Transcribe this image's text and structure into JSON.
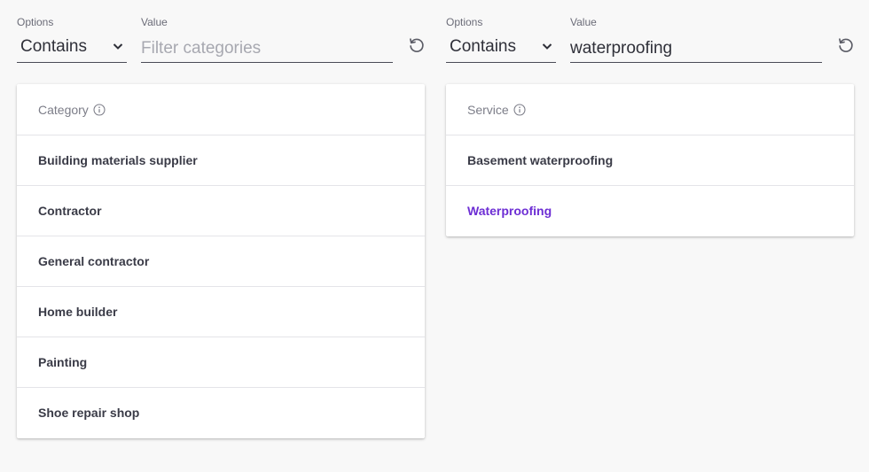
{
  "colors": {
    "accent": "#6d2ed4",
    "text": "#3a3b47",
    "muted": "#7c7d88",
    "background": "#f8f8f8",
    "card": "#ffffff"
  },
  "category_filter": {
    "options_label": "Options",
    "value_label": "Value",
    "selected_option": "Contains",
    "input_value": "",
    "placeholder": "Filter categories",
    "reset_icon": "reset-icon"
  },
  "service_filter": {
    "options_label": "Options",
    "value_label": "Value",
    "selected_option": "Contains",
    "input_value": "waterproofing",
    "placeholder": "",
    "reset_icon": "reset-icon"
  },
  "category_list": {
    "header": "Category",
    "header_icon": "info-icon",
    "items": [
      "Building materials supplier",
      "Contractor",
      "General contractor",
      "Home builder",
      "Painting",
      "Shoe repair shop"
    ]
  },
  "service_list": {
    "header": "Service",
    "header_icon": "info-icon",
    "items": [
      "Basement waterproofing",
      "Waterproofing"
    ],
    "highlighted_item": "Waterproofing"
  }
}
